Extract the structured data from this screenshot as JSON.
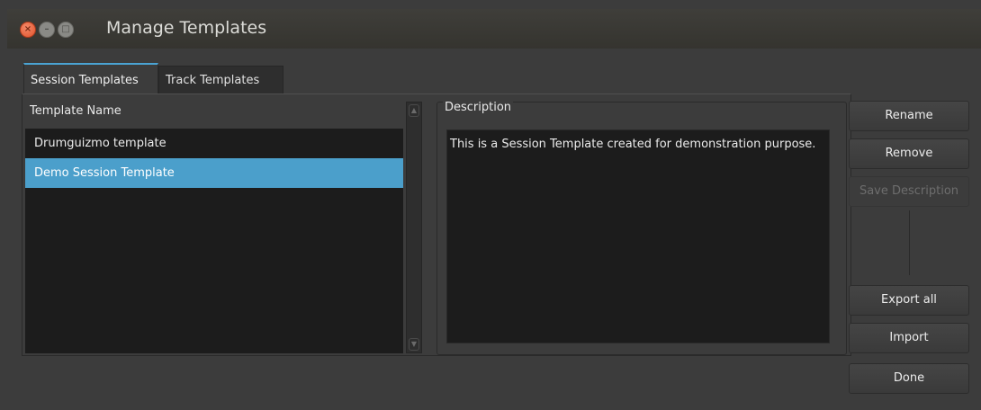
{
  "window": {
    "title": "Manage Templates"
  },
  "tabs": [
    {
      "label": "Session Templates",
      "active": true
    },
    {
      "label": "Track Templates",
      "active": false
    }
  ],
  "list": {
    "header": "Template Name",
    "items": [
      {
        "label": "Drumguizmo template",
        "selected": false
      },
      {
        "label": "Demo Session Template",
        "selected": true
      }
    ]
  },
  "description": {
    "label": "Description",
    "text": "This is a Session Template created for demonstration purpose."
  },
  "buttons": {
    "rename": "Rename",
    "remove": "Remove",
    "save_description": "Save Description",
    "export_all": "Export all",
    "import": "Import",
    "done": "Done"
  },
  "colors": {
    "accent": "#4aa3d3",
    "selection": "#4b9fcb",
    "close": "#e0522b"
  }
}
